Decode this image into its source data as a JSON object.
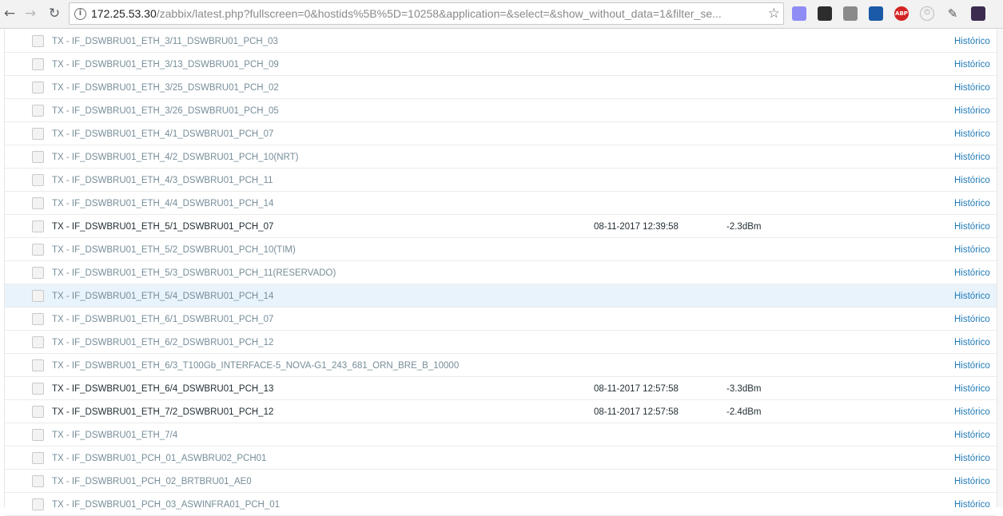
{
  "browser": {
    "nav": {
      "back_icon": "←",
      "forward_icon": "→",
      "reload_icon": "↻"
    },
    "info_icon": "i",
    "url_host": "172.25.53.30",
    "url_rest": "/zabbix/latest.php?fullscreen=0&hostids%5B%5D=10258&application=&select=&show_without_data=1&filter_se...",
    "star_icon": "☆",
    "extensions": [
      {
        "name": "extension-privacy-icon",
        "glyph": ""
      },
      {
        "name": "extension-tampermonkey-icon",
        "glyph": ""
      },
      {
        "name": "extension-gray-icon",
        "glyph": ""
      },
      {
        "name": "extension-blue-icon",
        "glyph": ""
      },
      {
        "name": "adblock-plus-icon",
        "glyph": "ABP"
      },
      {
        "name": "extension-power-icon",
        "glyph": "⏻"
      },
      {
        "name": "eyedropper-icon",
        "glyph": "✎"
      },
      {
        "name": "extension-dark-icon",
        "glyph": ""
      }
    ]
  },
  "table": {
    "history_label": "Histórico",
    "rows": [
      {
        "name": "TX - IF_DSWBRU01_ETH_3/11_DSWBRU01_PCH_03",
        "time": "",
        "value": "",
        "history": "Histórico"
      },
      {
        "name": "TX - IF_DSWBRU01_ETH_3/13_DSWBRU01_PCH_09",
        "time": "",
        "value": "",
        "history": "Histórico"
      },
      {
        "name": "TX - IF_DSWBRU01_ETH_3/25_DSWBRU01_PCH_02",
        "time": "",
        "value": "",
        "history": "Histórico"
      },
      {
        "name": "TX - IF_DSWBRU01_ETH_3/26_DSWBRU01_PCH_05",
        "time": "",
        "value": "",
        "history": "Histórico"
      },
      {
        "name": "TX - IF_DSWBRU01_ETH_4/1_DSWBRU01_PCH_07",
        "time": "",
        "value": "",
        "history": "Histórico"
      },
      {
        "name": "TX - IF_DSWBRU01_ETH_4/2_DSWBRU01_PCH_10(NRT)",
        "time": "",
        "value": "",
        "history": "Histórico"
      },
      {
        "name": "TX - IF_DSWBRU01_ETH_4/3_DSWBRU01_PCH_11",
        "time": "",
        "value": "",
        "history": "Histórico"
      },
      {
        "name": "TX - IF_DSWBRU01_ETH_4/4_DSWBRU01_PCH_14",
        "time": "",
        "value": "",
        "history": "Histórico"
      },
      {
        "name": "TX - IF_DSWBRU01_ETH_5/1_DSWBRU01_PCH_07",
        "time": "08-11-2017 12:39:58",
        "value": "-2.3dBm",
        "history": "Histórico"
      },
      {
        "name": "TX - IF_DSWBRU01_ETH_5/2_DSWBRU01_PCH_10(TIM)",
        "time": "",
        "value": "",
        "history": "Histórico"
      },
      {
        "name": "TX - IF_DSWBRU01_ETH_5/3_DSWBRU01_PCH_11(RESERVADO)",
        "time": "",
        "value": "",
        "history": "Histórico"
      },
      {
        "name": "TX - IF_DSWBRU01_ETH_5/4_DSWBRU01_PCH_14",
        "time": "",
        "value": "",
        "history": "Histórico"
      },
      {
        "name": "TX - IF_DSWBRU01_ETH_6/1_DSWBRU01_PCH_07",
        "time": "",
        "value": "",
        "history": "Histórico"
      },
      {
        "name": "TX - IF_DSWBRU01_ETH_6/2_DSWBRU01_PCH_12",
        "time": "",
        "value": "",
        "history": "Histórico"
      },
      {
        "name": "TX - IF_DSWBRU01_ETH_6/3_T100Gb_INTERFACE-5_NOVA-G1_243_681_ORN_BRE_B_10000",
        "time": "",
        "value": "",
        "history": "Histórico"
      },
      {
        "name": "TX - IF_DSWBRU01_ETH_6/4_DSWBRU01_PCH_13",
        "time": "08-11-2017 12:57:58",
        "value": "-3.3dBm",
        "history": "Histórico"
      },
      {
        "name": "TX - IF_DSWBRU01_ETH_7/2_DSWBRU01_PCH_12",
        "time": "08-11-2017 12:57:58",
        "value": "-2.4dBm",
        "history": "Histórico"
      },
      {
        "name": "TX - IF_DSWBRU01_ETH_7/4",
        "time": "",
        "value": "",
        "history": "Histórico"
      },
      {
        "name": "TX - IF_DSWBRU01_PCH_01_ASWBRU02_PCH01",
        "time": "",
        "value": "",
        "history": "Histórico"
      },
      {
        "name": "TX - IF_DSWBRU01_PCH_02_BRTBRU01_AE0",
        "time": "",
        "value": "",
        "history": "Histórico"
      },
      {
        "name": "TX - IF_DSWBRU01_PCH_03_ASWINFRA01_PCH_01",
        "time": "",
        "value": "",
        "history": "Histórico"
      }
    ]
  }
}
